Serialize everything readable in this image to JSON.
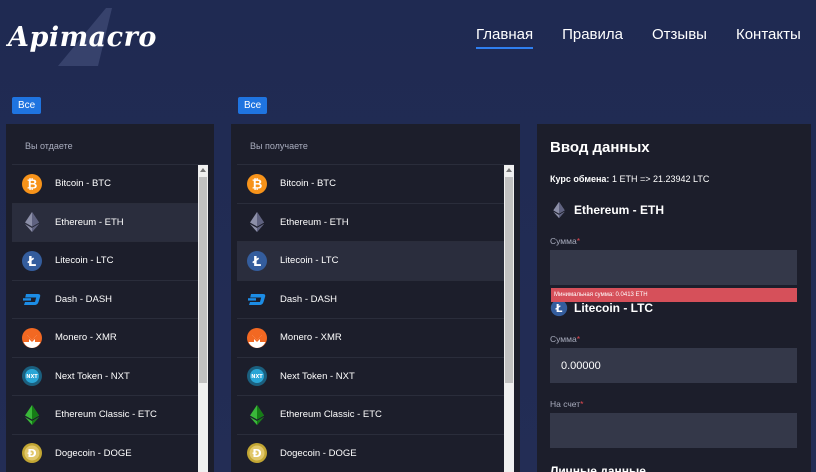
{
  "brand": {
    "logo_text": "Apimacro"
  },
  "nav": {
    "items": [
      "Главная",
      "Правила",
      "Отзывы",
      "Контакты"
    ],
    "active_index": 0,
    "accent_color": "#2f7ff0"
  },
  "give_panel": {
    "filter_label": "Все",
    "header": "Вы отдаете",
    "selected_index": 1,
    "items": [
      {
        "label": "Bitcoin - BTC",
        "icon": "bitcoin-icon"
      },
      {
        "label": "Ethereum - ETH",
        "icon": "ethereum-icon"
      },
      {
        "label": "Litecoin - LTC",
        "icon": "litecoin-icon"
      },
      {
        "label": "Dash - DASH",
        "icon": "dash-icon"
      },
      {
        "label": "Monero - XMR",
        "icon": "monero-icon"
      },
      {
        "label": "Next Token - NXT",
        "icon": "nxt-icon"
      },
      {
        "label": "Ethereum Classic - ETC",
        "icon": "ethereum-classic-icon"
      },
      {
        "label": "Dogecoin - DOGE",
        "icon": "dogecoin-icon"
      }
    ]
  },
  "get_panel": {
    "filter_label": "Все",
    "header": "Вы получаете",
    "selected_index": 2,
    "items": [
      {
        "label": "Bitcoin - BTC",
        "icon": "bitcoin-icon"
      },
      {
        "label": "Ethereum - ETH",
        "icon": "ethereum-icon"
      },
      {
        "label": "Litecoin - LTC",
        "icon": "litecoin-icon"
      },
      {
        "label": "Dash - DASH",
        "icon": "dash-icon"
      },
      {
        "label": "Monero - XMR",
        "icon": "monero-icon"
      },
      {
        "label": "Next Token - NXT",
        "icon": "nxt-icon"
      },
      {
        "label": "Ethereum Classic - ETC",
        "icon": "ethereum-classic-icon"
      },
      {
        "label": "Dogecoin - DOGE",
        "icon": "dogecoin-icon"
      }
    ]
  },
  "form": {
    "title": "Ввод данных",
    "rate_label": "Курс обмена:",
    "rate_value": "1 ETH => 21.23942 LTC",
    "give_currency": "Ethereum - ETH",
    "give_amount_label": "Сумма",
    "give_amount_value": "",
    "min_error": "Минимальная сумма: 0.0413 ETH",
    "get_currency": "Litecoin - LTC",
    "get_amount_label": "Сумма",
    "get_amount_value": "0.00000",
    "account_label": "На счет",
    "account_value": "",
    "required_mark": "*",
    "personal_section": "Личные данные"
  },
  "colors": {
    "background": "#1f2a52",
    "panel": "#1c1e2b",
    "input": "#343849",
    "error": "#d6505a",
    "badge": "#1f74e0"
  }
}
